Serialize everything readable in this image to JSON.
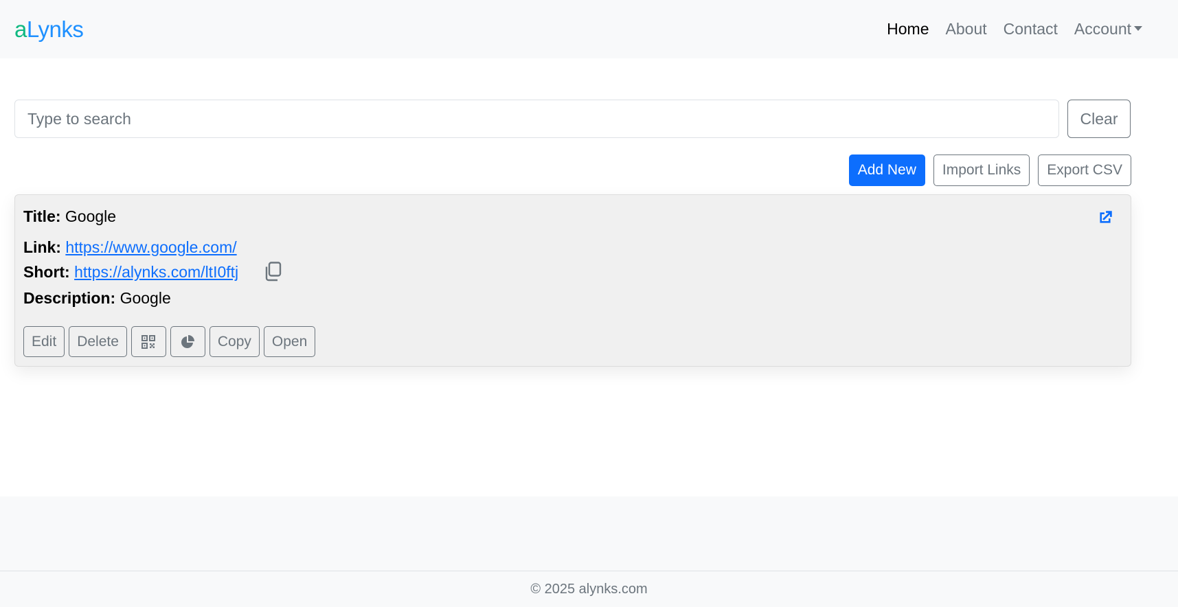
{
  "brand": {
    "prefix": "a",
    "rest": "Lynks"
  },
  "nav": {
    "home": "Home",
    "about": "About",
    "contact": "Contact",
    "account": "Account"
  },
  "search": {
    "placeholder": "Type to search",
    "value": "",
    "clear_label": "Clear"
  },
  "actions": {
    "add_new": "Add New",
    "import_links": "Import Links",
    "export_csv": "Export CSV"
  },
  "links": [
    {
      "title_label": "Title:",
      "title": "Google",
      "link_label": "Link:",
      "link": "https://www.google.com/",
      "short_label": "Short:",
      "short": "https://alynks.com/ltI0ftj",
      "description_label": "Description:",
      "description": "Google",
      "buttons": {
        "edit": "Edit",
        "delete": "Delete",
        "copy": "Copy",
        "open": "Open"
      },
      "icons": [
        "qr-code-icon",
        "pie-chart-icon",
        "copy-clipboard-icon",
        "external-link-icon"
      ]
    }
  ],
  "footer": {
    "text": "© 2025 alynks.com"
  },
  "colors": {
    "primary": "#0d6efd",
    "secondary": "#6c757d",
    "brand_green": "#10b981",
    "brand_blue": "#1e90ff",
    "card_bg": "#f0f0f0",
    "navbar_bg": "#f8f9fa"
  }
}
